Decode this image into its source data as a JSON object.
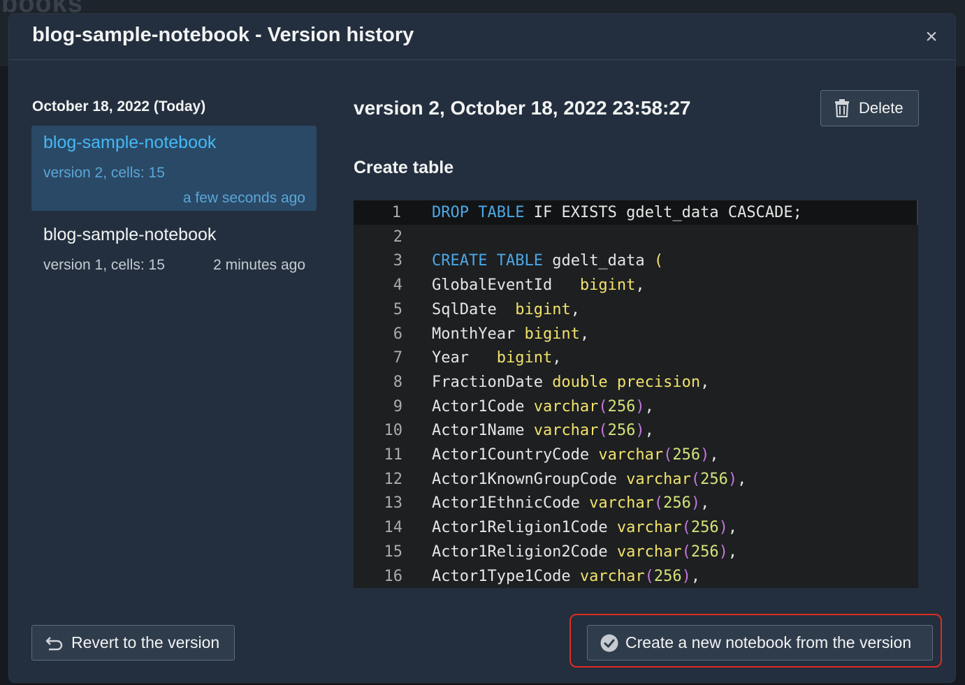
{
  "background": {
    "title_fragment": "books"
  },
  "modal": {
    "title": "blog-sample-notebook - Version history",
    "close_glyph": "×"
  },
  "sidebar": {
    "date_heading": "October 18, 2022 (Today)",
    "versions": [
      {
        "name": "blog-sample-notebook",
        "meta": "version 2, cells: 15",
        "time": "a few seconds ago",
        "selected": true
      },
      {
        "name": "blog-sample-notebook",
        "meta": "version 1, cells: 15",
        "time": "2 minutes ago",
        "selected": false
      }
    ]
  },
  "detail": {
    "version_title": "version 2, October 18, 2022 23:58:27",
    "delete_label": "Delete",
    "cell_title": "Create table",
    "code_lines": [
      "DROP TABLE IF EXISTS gdelt_data CASCADE;",
      "",
      "CREATE TABLE gdelt_data (",
      "GlobalEventId   bigint,",
      "SqlDate  bigint,",
      "MonthYear bigint,",
      "Year   bigint,",
      "FractionDate double precision,",
      "Actor1Code varchar(256),",
      "Actor1Name varchar(256),",
      "Actor1CountryCode varchar(256),",
      "Actor1KnownGroupCode varchar(256),",
      "Actor1EthnicCode varchar(256),",
      "Actor1Religion1Code varchar(256),",
      "Actor1Religion2Code varchar(256),",
      "Actor1Type1Code varchar(256),"
    ]
  },
  "footer": {
    "revert_label": "Revert to the version",
    "create_label": "Create a new notebook from the version"
  },
  "colors": {
    "modal_bg": "#232f3e",
    "selected_bg": "#2a4966",
    "accent_blue": "#44b9f6",
    "keyword": "#4aa8e8",
    "type": "#f2e26b",
    "highlight_ring": "#e02c20"
  },
  "icons": {
    "close": "close-icon",
    "delete": "trash-icon",
    "revert": "undo-arrow-icon",
    "create": "check-circle-icon"
  }
}
